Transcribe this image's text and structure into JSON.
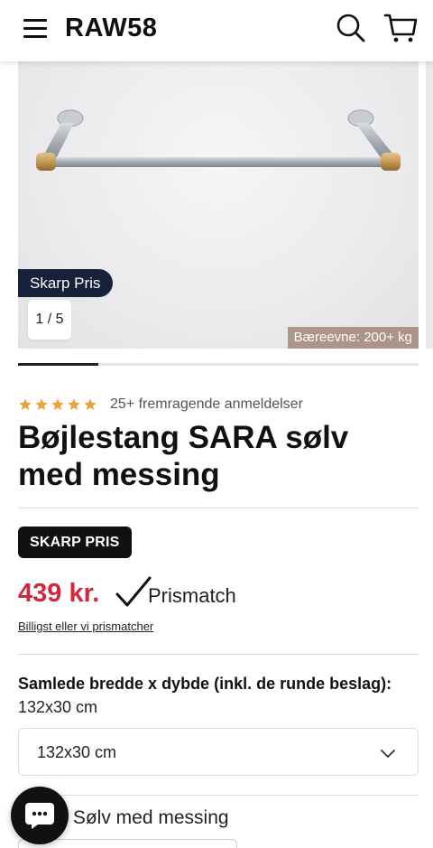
{
  "header": {
    "logo": "RAW58",
    "menu_icon": "hamburger-menu-icon",
    "search_icon": "search-icon",
    "cart_icon": "shopping-cart-icon"
  },
  "gallery": {
    "sale_tag": "Skarp Pris",
    "counter": "1 / 5",
    "capacity_label": "Bæreevne: 200+ kg",
    "progress": 0.2
  },
  "rating": {
    "stars": 5,
    "star_color": "#e8a33d",
    "reviews_text": "25+ fremragende anmeldelser"
  },
  "product": {
    "title": "Bøjlestang SARA sølv med messing"
  },
  "badge": {
    "label": "SKARP PRIS"
  },
  "price": {
    "value": "439 kr.",
    "color": "#d0283d",
    "prismatch_label": "Prismatch",
    "prismatch_link": "Billigst eller vi prismatcher"
  },
  "size_option": {
    "label": "Samlede bredde x dybde (inkl. de runde beslag):",
    "current_value": "132x30 cm",
    "selected": "132x30 cm"
  },
  "color_option": {
    "label_suffix": ":",
    "value": "Sølv med messing"
  },
  "chat": {
    "icon": "chat-icon"
  }
}
